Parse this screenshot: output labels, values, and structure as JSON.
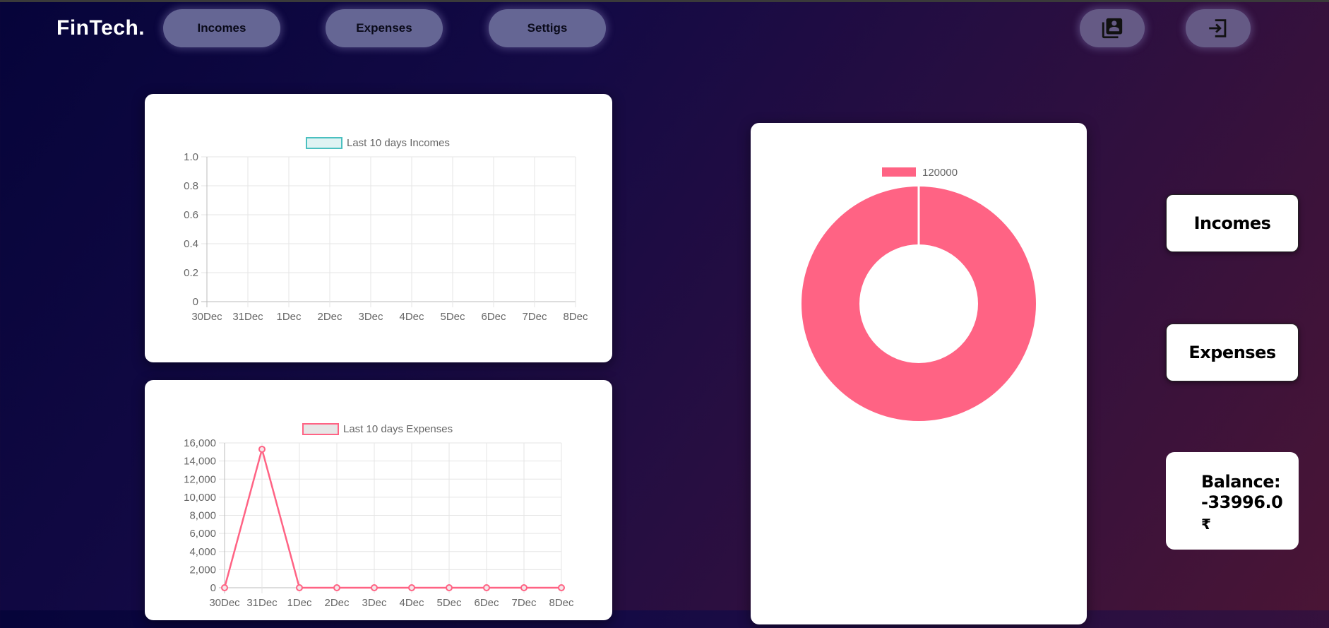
{
  "brand": "FinTech.",
  "nav": {
    "incomes": "Incomes",
    "expenses": "Expenses",
    "settings": "Settigs"
  },
  "icons": {
    "profile": "contacts-book-icon",
    "logout": "logout-icon"
  },
  "income_chart_legend": "Last 10 days Incomes",
  "expense_chart_legend": "Last 10 days Expenses",
  "donut_legend": "120000",
  "side": {
    "incomes": "Incomes",
    "expenses": "Expenses"
  },
  "balance": {
    "label": "Balance:",
    "value": "-33996.0",
    "currency": "₹"
  },
  "colors": {
    "income": "#4bc0c0",
    "expense": "#ff6384",
    "donut": "#ff6384"
  },
  "chart_data": [
    {
      "type": "line",
      "title": "",
      "categories": [
        "30Dec",
        "31Dec",
        "1Dec",
        "2Dec",
        "3Dec",
        "4Dec",
        "5Dec",
        "6Dec",
        "7Dec",
        "8Dec"
      ],
      "series": [
        {
          "name": "Last 10 days Incomes",
          "values": []
        }
      ],
      "yticks": [
        "0",
        "0.2",
        "0.4",
        "0.6",
        "0.8",
        "1.0"
      ],
      "ylim": [
        0,
        1.0
      ],
      "grid": true,
      "legend": "top"
    },
    {
      "type": "line",
      "title": "",
      "categories": [
        "30Dec",
        "31Dec",
        "1Dec",
        "2Dec",
        "3Dec",
        "4Dec",
        "5Dec",
        "6Dec",
        "7Dec",
        "8Dec"
      ],
      "series": [
        {
          "name": "Last 10 days Expenses",
          "values": [
            0,
            15300,
            0,
            0,
            0,
            0,
            0,
            0,
            0,
            0
          ]
        }
      ],
      "yticks": [
        "0",
        "2,000",
        "4,000",
        "6,000",
        "8,000",
        "10,000",
        "12,000",
        "14,000",
        "16,000"
      ],
      "ylim": [
        0,
        16000
      ],
      "grid": true,
      "legend": "top"
    },
    {
      "type": "pie",
      "title": "",
      "categories": [
        "120000"
      ],
      "values": [
        120000
      ],
      "legend": "top"
    }
  ]
}
